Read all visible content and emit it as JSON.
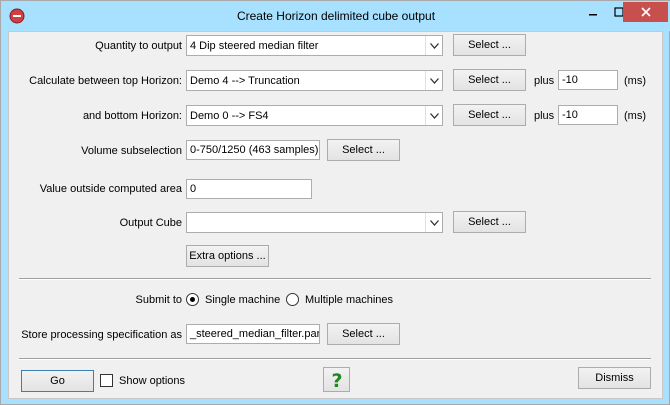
{
  "window": {
    "title": "Create Horizon delimited cube output"
  },
  "form": {
    "quantity": {
      "label": "Quantity to output",
      "value": "4 Dip steered median filter",
      "select_label": "Select ..."
    },
    "top_horizon": {
      "label": "Calculate between top Horizon:",
      "value": "Demo 4 --> Truncation",
      "select_label": "Select ...",
      "plus_label": "plus",
      "offset": "-10",
      "unit": "(ms)"
    },
    "bottom_horizon": {
      "label": "and bottom Horizon:",
      "value": "Demo 0 --> FS4",
      "select_label": "Select ...",
      "plus_label": "plus",
      "offset": "-10",
      "unit": "(ms)"
    },
    "volume": {
      "label": "Volume subselection",
      "value": "0-750/1250 (463 samples)",
      "select_label": "Select ..."
    },
    "outside_value": {
      "label": "Value outside computed area",
      "value": "0"
    },
    "output_cube": {
      "label": "Output Cube",
      "value": "",
      "select_label": "Select ..."
    },
    "extra_options_label": "Extra options ..."
  },
  "submit": {
    "label": "Submit to",
    "options": [
      "Single machine",
      "Multiple machines"
    ],
    "selected": "Single machine"
  },
  "store": {
    "label": "Store processing specification as",
    "value": "_steered_median_filter.par",
    "select_label": "Select ..."
  },
  "footer": {
    "go_label": "Go",
    "show_options_label": "Show options",
    "dismiss_label": "Dismiss"
  },
  "icons": {
    "app": "app-logo-icon",
    "help": "help-question-icon"
  },
  "colors": {
    "titlebar": "#a8e0ff",
    "close": "#c7504f",
    "help": "#1e8a1e"
  }
}
